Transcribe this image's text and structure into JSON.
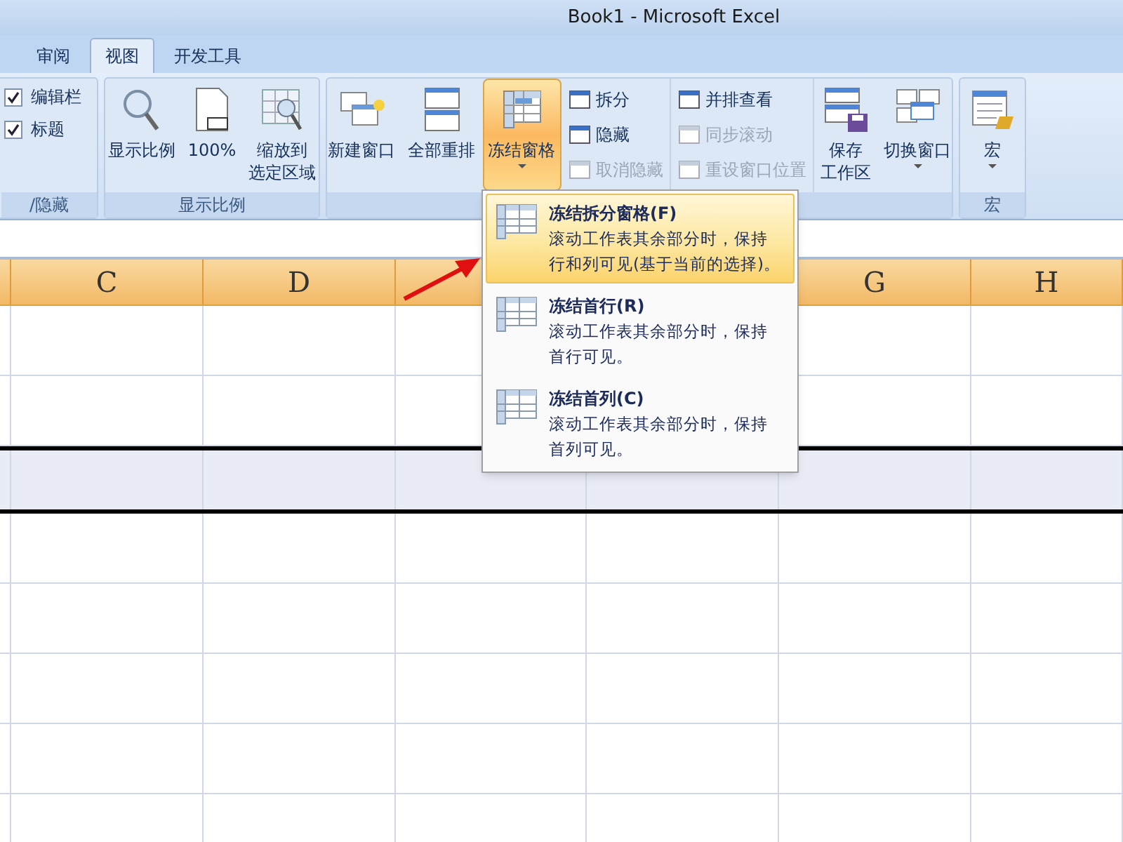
{
  "window": {
    "title": "Book1 - Microsoft Excel"
  },
  "tabs": [
    {
      "label": "审阅",
      "selected": false
    },
    {
      "label": "视图",
      "selected": true
    },
    {
      "label": "开发工具",
      "selected": false
    }
  ],
  "ribbon_groups": [
    {
      "label": "/隐藏",
      "items": [
        {
          "kind": "checkbox",
          "label": [
            "编辑栏"
          ],
          "checked": true
        },
        {
          "kind": "checkbox",
          "label": [
            "标题"
          ],
          "checked": true
        }
      ]
    },
    {
      "label": "显示比例",
      "items": [
        {
          "kind": "large",
          "label": [
            "显示比例"
          ]
        },
        {
          "kind": "large",
          "label": [
            "100%"
          ]
        },
        {
          "kind": "large",
          "label": [
            "缩放到",
            "选定区域"
          ]
        }
      ]
    },
    {
      "items": [
        {
          "kind": "large",
          "label": [
            "新建窗口"
          ]
        },
        {
          "kind": "large",
          "label": [
            "全部重排"
          ]
        },
        {
          "kind": "large",
          "label": [
            "冻结窗格"
          ],
          "selected": true,
          "dropdown": true
        },
        {
          "kind": "stack",
          "items": [
            {
              "label": "拆分",
              "disabled": false
            },
            {
              "label": "隐藏",
              "disabled": false
            },
            {
              "label": "取消隐藏",
              "disabled": true
            }
          ]
        },
        {
          "kind": "stack",
          "items": [
            {
              "label": "并排查看",
              "disabled": false
            },
            {
              "label": "同步滚动",
              "disabled": true
            },
            {
              "label": "重设窗口位置",
              "disabled": true
            }
          ]
        },
        {
          "kind": "large",
          "label": [
            "保存",
            "工作区"
          ]
        },
        {
          "kind": "large",
          "label": [
            "切换窗口"
          ],
          "dropdown": true
        }
      ]
    },
    {
      "label": "宏",
      "items": [
        {
          "kind": "large",
          "label": [
            "宏"
          ],
          "dropdown": true
        }
      ]
    }
  ],
  "columns": [
    "C",
    "D",
    "G",
    "H"
  ],
  "freeze_menu": [
    {
      "title": "冻结拆分窗格(F)",
      "description": [
        "滚动工作表其余部分时，保持",
        "行和列可见(基于当前的选择)。"
      ],
      "selected": true
    },
    {
      "title": "冻结首行(R)",
      "description": [
        "滚动工作表其余部分时，保持",
        "首行可见。"
      ],
      "selected": false
    },
    {
      "title": "冻结首列(C)",
      "description": [
        "滚动工作表其余部分时，保持",
        "首列可见。"
      ],
      "selected": false
    }
  ]
}
